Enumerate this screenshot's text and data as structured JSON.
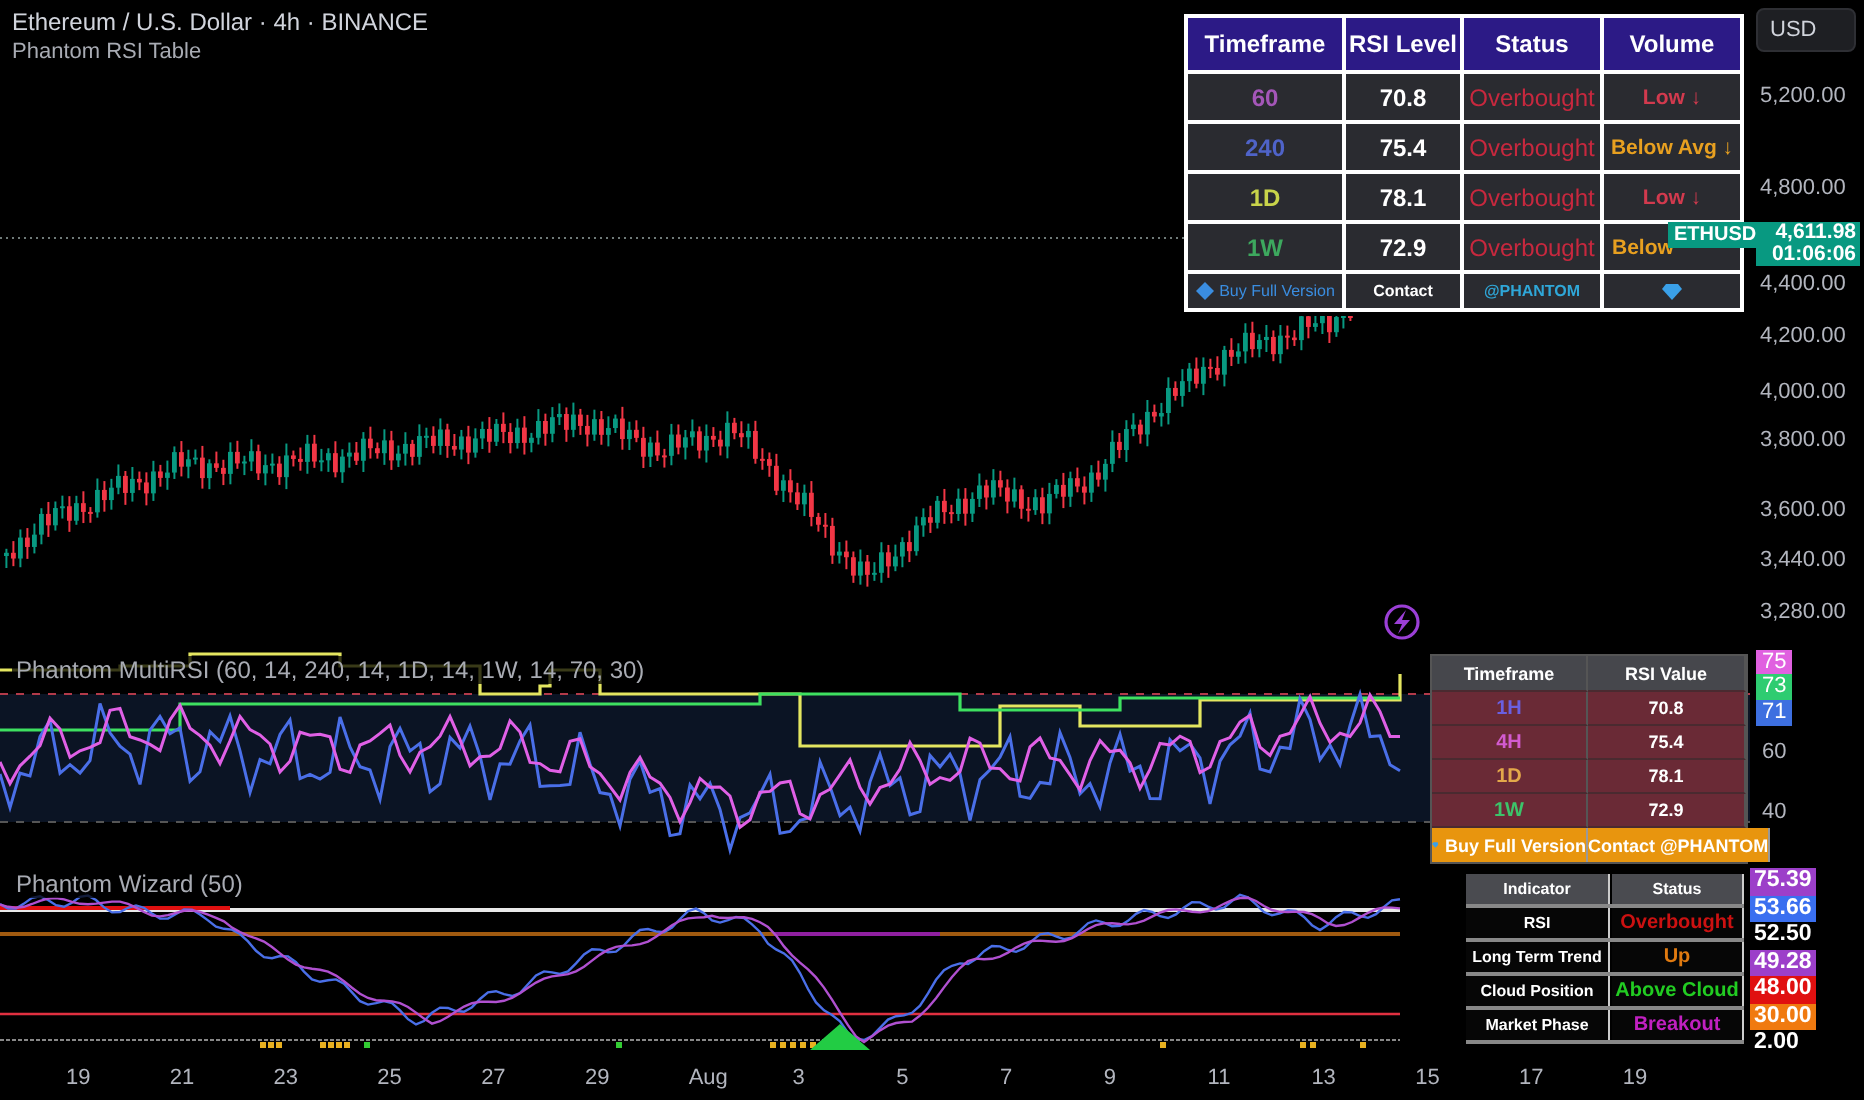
{
  "header": {
    "title": "Ethereum / U.S. Dollar · 4h · BINANCE",
    "subtitle": "Phantom RSI Table"
  },
  "currency_button": "USD",
  "rsi_table": {
    "columns": [
      "Timeframe",
      "RSI Level",
      "Status",
      "Volume"
    ],
    "rows": [
      {
        "timeframe": "60",
        "color": "#a456b8",
        "rsi": "70.8",
        "status": "Overbought",
        "volume": {
          "text": "Low ↓",
          "color": "#d23a4e"
        }
      },
      {
        "timeframe": "240",
        "color": "#4f63c8",
        "rsi": "75.4",
        "status": "Overbought",
        "volume": {
          "text": "Below Avg ↓",
          "color": "#e8a020"
        }
      },
      {
        "timeframe": "1D",
        "color": "#c9d44a",
        "rsi": "78.1",
        "status": "Overbought",
        "volume": {
          "text": "Low ↓",
          "color": "#d23a4e"
        }
      },
      {
        "timeframe": "1W",
        "color": "#3da85e",
        "rsi": "72.9",
        "status": "Overbought",
        "volume": {
          "text": "Below",
          "color": "#e8a020"
        }
      }
    ],
    "footer": [
      "Buy Full Version",
      "Contact",
      "@PHANTOM"
    ]
  },
  "symbol_badge": "ETHUSD",
  "price_badge": {
    "price": "4,611.98",
    "countdown": "01:06:06"
  },
  "price_axis": [
    "5,200.00",
    "4,800.00",
    "4,400.00",
    "4,200.00",
    "4,000.00",
    "3,800.00",
    "3,600.00",
    "3,440.00",
    "3,280.00"
  ],
  "multi_rsi": {
    "legend": "Phantom MultiRSI (60, 14, 240, 14, 1D, 14, 1W, 14, 70, 30)",
    "table": {
      "columns": [
        "Timeframe",
        "RSI Value"
      ],
      "rows": [
        {
          "timeframe": "1H",
          "color": "#6a5fe0",
          "value": "70.8"
        },
        {
          "timeframe": "4H",
          "color": "#d35bd0",
          "value": "75.4"
        },
        {
          "timeframe": "1D",
          "color": "#e3a84a",
          "value": "78.1"
        },
        {
          "timeframe": "1W",
          "color": "#3cc46a",
          "value": "72.9"
        }
      ],
      "footer": [
        "Buy Full Version",
        "Contact @PHANTOM"
      ]
    },
    "axis_badges": [
      {
        "text": "75",
        "color": "#e060e0"
      },
      {
        "text": "73",
        "color": "#2ecc71"
      },
      {
        "text": "71",
        "color": "#3d6fe0"
      }
    ],
    "axis": [
      "60",
      "40"
    ]
  },
  "wizard": {
    "legend": "Phantom Wizard (50)",
    "table": {
      "columns": [
        "Indicator",
        "Status"
      ],
      "rows": [
        {
          "indicator": "RSI",
          "status": "Overbought",
          "color": "#cc1111"
        },
        {
          "indicator": "Long Term Trend",
          "status": "Up",
          "color": "#e07a10"
        },
        {
          "indicator": "Cloud Position",
          "status": "Above Cloud",
          "color": "#22cc22"
        },
        {
          "indicator": "Market Phase",
          "status": "Breakout",
          "color": "#c020c0"
        }
      ]
    },
    "axis": [
      {
        "text": "75.39",
        "color": "#9c3fc9"
      },
      {
        "text": "53.66",
        "color": "#3a6ff0"
      },
      {
        "text": "52.50"
      },
      {
        "text": "49.28",
        "color": "#9c3fc9"
      },
      {
        "text": "48.00",
        "color": "#e01010"
      },
      {
        "text": "30.00",
        "color": "#f07a10"
      },
      {
        "text": "2.00"
      }
    ]
  },
  "time_axis": [
    "19",
    "21",
    "23",
    "25",
    "27",
    "29",
    "Aug",
    "3",
    "5",
    "7",
    "9",
    "11",
    "13",
    "15",
    "17",
    "19"
  ]
}
